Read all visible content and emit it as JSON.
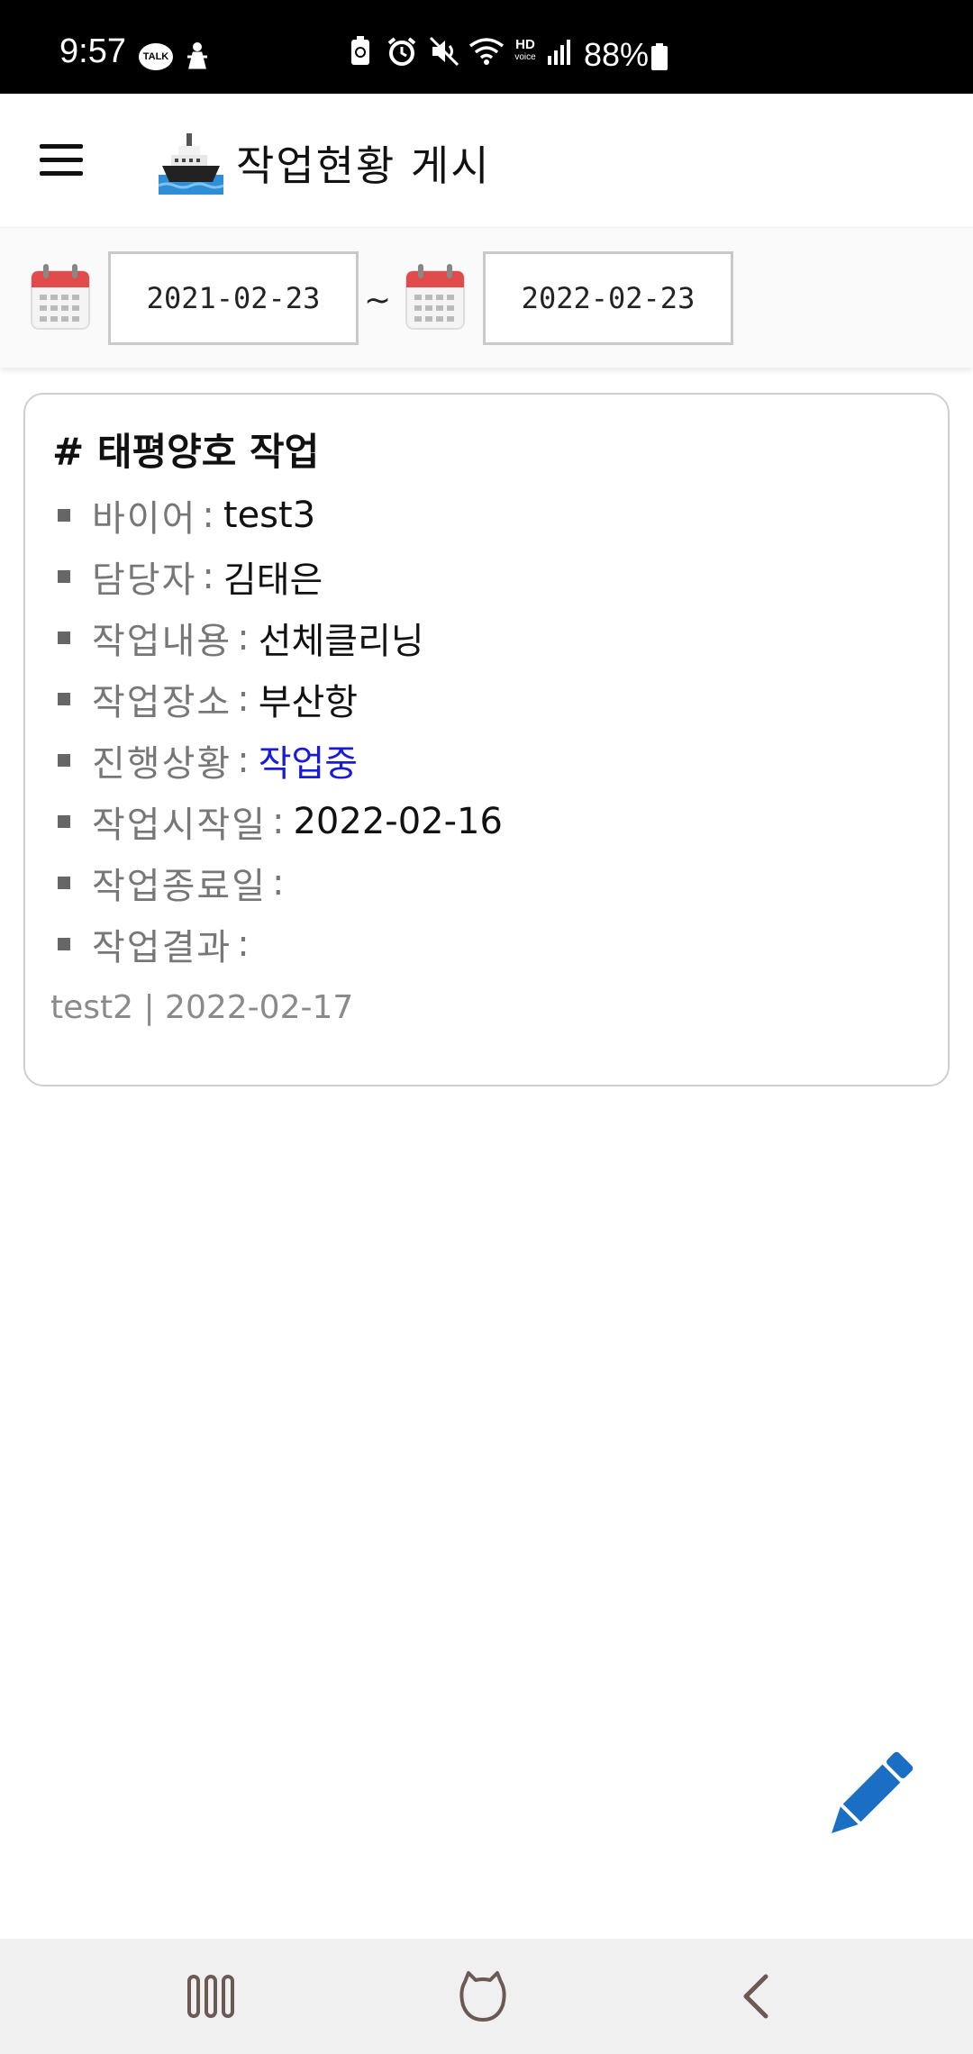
{
  "status_bar": {
    "time": "9:57",
    "battery": "88%",
    "icons": [
      "kakaotalk-icon",
      "person-icon",
      "battery-saver-icon",
      "alarm-icon",
      "mute-icon",
      "wifi-icon",
      "hd-voice-icon",
      "signal-icon",
      "battery-icon"
    ],
    "talk_label": "TALK",
    "hd_label": "HD",
    "voice_label": "voice"
  },
  "header": {
    "title": "작업현황 게시",
    "menu_icon": "hamburger-menu-icon",
    "logo_icon": "ship-icon"
  },
  "filter": {
    "start_date": "2021-02-23",
    "separator": "~",
    "end_date": "2022-02-23",
    "calendar_icon": "calendar-icon"
  },
  "card": {
    "title": "# 태평양호 작업",
    "fields": [
      {
        "label": "바이어",
        "value": "test3"
      },
      {
        "label": "담당자",
        "value": "김태은"
      },
      {
        "label": "작업내용",
        "value": "선체클리닝"
      },
      {
        "label": "작업장소",
        "value": "부산항"
      },
      {
        "label": "진행상황",
        "value": "작업중"
      },
      {
        "label": "작업시작일",
        "value": "2022-02-16"
      },
      {
        "label": "작업종료일",
        "value": ""
      },
      {
        "label": "작업결과",
        "value": ""
      }
    ],
    "colon": ":",
    "footer": "test2 | 2022-02-17",
    "status_color": "#1a1adb"
  },
  "fab": {
    "icon": "pencil-icon",
    "color": "#1a6fc4"
  },
  "nav_bar": {
    "icons": [
      "recent-apps-icon",
      "home-icon",
      "back-icon"
    ]
  }
}
